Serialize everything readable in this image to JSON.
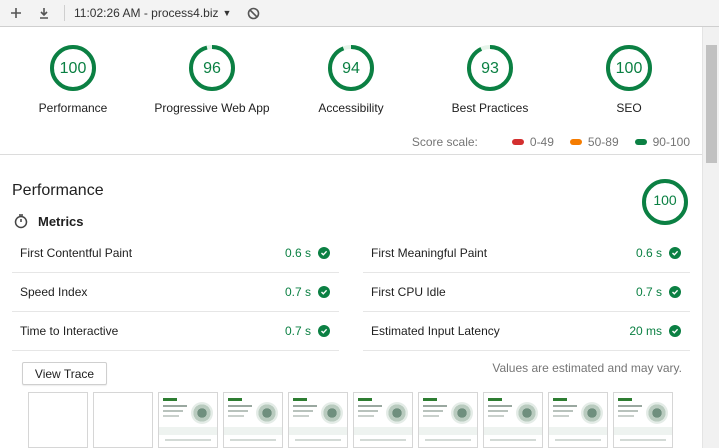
{
  "toolbar": {
    "report_label": "11:02:26 AM - process4.biz",
    "icons": [
      "plus-icon",
      "download-icon",
      "caret-down-icon",
      "block-icon"
    ]
  },
  "categories": [
    {
      "label": "Performance",
      "score": "100",
      "fraction": 1.0
    },
    {
      "label": "Progressive Web App",
      "score": "96",
      "fraction": 0.96
    },
    {
      "label": "Accessibility",
      "score": "94",
      "fraction": 0.94
    },
    {
      "label": "Best Practices",
      "score": "93",
      "fraction": 0.93
    },
    {
      "label": "SEO",
      "score": "100",
      "fraction": 1.0
    }
  ],
  "scale": {
    "title": "Score scale:",
    "ranges": [
      {
        "label": "0-49",
        "color": "#d32f2f"
      },
      {
        "label": "50-89",
        "color": "#f57c00"
      },
      {
        "label": "90-100",
        "color": "#0b8043"
      }
    ]
  },
  "performance": {
    "title": "Performance",
    "score": "100",
    "fraction": 1.0,
    "metrics_title": "Metrics",
    "metrics": [
      {
        "name": "First Contentful Paint",
        "value": "0.6 s"
      },
      {
        "name": "First Meaningful Paint",
        "value": "0.6 s"
      },
      {
        "name": "Speed Index",
        "value": "0.7 s"
      },
      {
        "name": "First CPU Idle",
        "value": "0.7 s"
      },
      {
        "name": "Time to Interactive",
        "value": "0.7 s"
      },
      {
        "name": "Estimated Input Latency",
        "value": "20 ms"
      }
    ],
    "view_trace_label": "View Trace",
    "estimate_note": "Values are estimated and may vary.",
    "filmstrip_frames": [
      "blank",
      "blank",
      "page",
      "page",
      "page",
      "page",
      "page",
      "page",
      "page",
      "page"
    ]
  },
  "colors": {
    "pass": "#0b8043",
    "pass_light": "#e6f4ea"
  }
}
